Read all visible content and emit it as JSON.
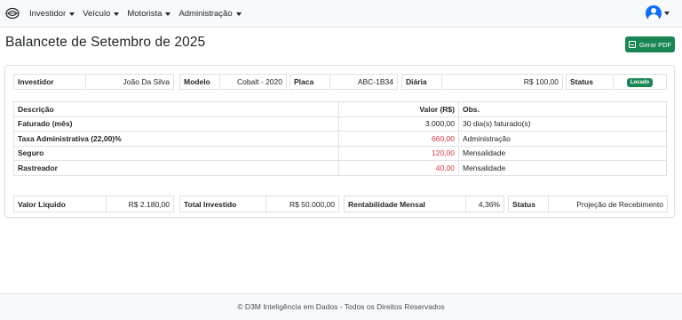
{
  "nav": {
    "items": [
      {
        "label": "Investidor"
      },
      {
        "label": "Veículo"
      },
      {
        "label": "Motorista"
      },
      {
        "label": "Administração"
      }
    ]
  },
  "header": {
    "title": "Balancete de Setembro de 2025",
    "pdf_button": "Gerar PDF"
  },
  "info": {
    "investor_label": "Investidor",
    "investor_value": "João Da Silva",
    "model_label": "Modelo",
    "model_value": "Cobalt - 2020",
    "plate_label": "Placa",
    "plate_value": "ABC-1B34",
    "daily_label": "Diária",
    "daily_value": "R$ 100,00",
    "status_label": "Status",
    "status_value": "Locado"
  },
  "breakdown": {
    "headers": [
      "Descrição",
      "Valor (R$)",
      "Obs."
    ],
    "rows": [
      {
        "description": "Faturado (mês)",
        "value": "3.000,00",
        "obs": "30 dia(s) faturado(s)"
      },
      {
        "description": "Taxa Administrativa (22,00)%",
        "value": "660,00",
        "obs": "Administração"
      },
      {
        "description": "Seguro",
        "value": "120,00",
        "obs": "Mensalidade"
      },
      {
        "description": "Rastreador",
        "value": "40,00",
        "obs": "Mensalidade"
      }
    ]
  },
  "summary": {
    "net_label": "Valor Líquido",
    "net_value": "R$ 2.180,00",
    "invested_label": "Total Investido",
    "invested_value": "R$ 50.000,00",
    "return_label": "Rentabilidade Mensal",
    "return_value": "4,36%",
    "status_label": "Status",
    "status_value": "Projeção de Recebimento"
  },
  "footer": {
    "text": "© D3M Inteligência em Dados - Todos os Direitos Reservados"
  },
  "colors": {
    "primary": "#0d6efd",
    "success": "#198754",
    "danger": "#dc3545"
  }
}
